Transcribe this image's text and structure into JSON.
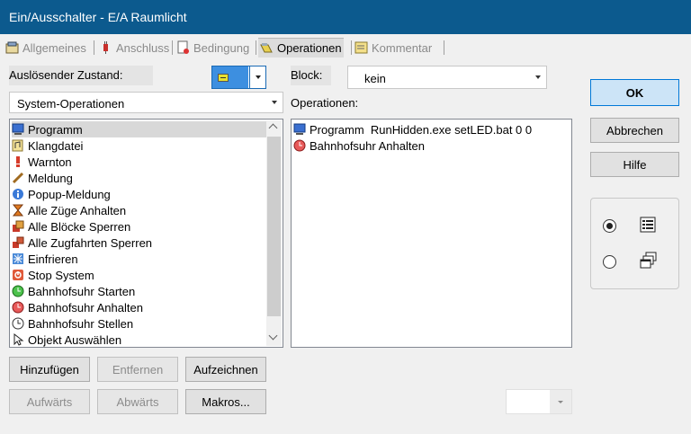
{
  "window": {
    "title": "Ein/Ausschalter - E/A Raumlicht"
  },
  "tabs": [
    {
      "label": "Allgemeines",
      "icon": "general-settings-icon"
    },
    {
      "label": "Anschluss",
      "icon": "plug-icon"
    },
    {
      "label": "Bedingung",
      "icon": "condition-icon"
    },
    {
      "label": "Operationen",
      "icon": "operations-icon"
    },
    {
      "label": "Kommentar",
      "icon": "comment-icon"
    }
  ],
  "trigger": {
    "label": "Auslösender Zustand:"
  },
  "category": {
    "value": "System-Operationen"
  },
  "block": {
    "label": "Block:",
    "value": "kein"
  },
  "operations": {
    "label": "Operationen:",
    "items": [
      {
        "text": "Programm  RunHidden.exe setLED.bat 0 0",
        "icon": "program-icon"
      },
      {
        "text": "Bahnhofsuhr Anhalten",
        "icon": "clock-stop-icon"
      }
    ]
  },
  "operation_list": [
    {
      "label": "Programm",
      "icon": "program-icon",
      "selected": true
    },
    {
      "label": "Klangdatei",
      "icon": "sound-file-icon"
    },
    {
      "label": "Warnton",
      "icon": "warning-tone-icon"
    },
    {
      "label": "Meldung",
      "icon": "message-pen-icon"
    },
    {
      "label": "Popup-Meldung",
      "icon": "info-popup-icon"
    },
    {
      "label": "Alle Züge Anhalten",
      "icon": "stop-trains-icon"
    },
    {
      "label": "Alle Blöcke Sperren",
      "icon": "lock-blocks-icon"
    },
    {
      "label": "Alle Zugfahrten Sperren",
      "icon": "lock-routes-icon"
    },
    {
      "label": "Einfrieren",
      "icon": "freeze-icon"
    },
    {
      "label": "Stop System",
      "icon": "stop-system-icon"
    },
    {
      "label": "Bahnhofsuhr Starten",
      "icon": "clock-start-icon"
    },
    {
      "label": "Bahnhofsuhr Anhalten",
      "icon": "clock-stop-icon"
    },
    {
      "label": "Bahnhofsuhr Stellen",
      "icon": "clock-set-icon"
    },
    {
      "label": "Objekt Auswählen",
      "icon": "cursor-select-icon"
    }
  ],
  "buttons": {
    "add": "Hinzufügen",
    "remove": "Entfernen",
    "record": "Aufzeichnen",
    "up": "Aufwärts",
    "down": "Abwärts",
    "macros": "Makros...",
    "ok": "OK",
    "cancel": "Abbrechen",
    "help": "Hilfe"
  },
  "view_mode": {
    "options": [
      "list-view-icon",
      "multi-window-icon"
    ],
    "selected": 0
  },
  "colors": {
    "titlebar": "#0c5a8e",
    "accent": "#0078d7",
    "ok_button": "#cce4f7"
  }
}
